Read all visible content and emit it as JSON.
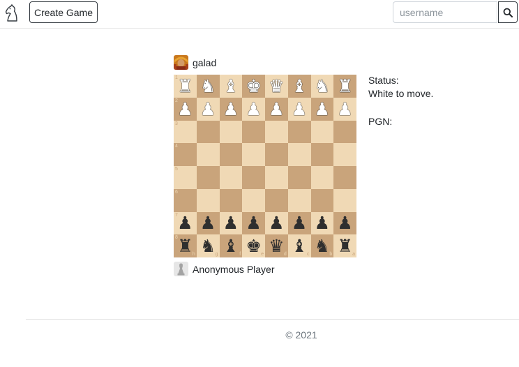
{
  "header": {
    "logo_icon": "knight-logo-icon",
    "create_button_label": "Create Game",
    "search": {
      "placeholder": "username",
      "value": "",
      "button_icon": "search-icon"
    }
  },
  "players": {
    "top": {
      "name": "galad",
      "avatar_icon": "user-avatar-icon"
    },
    "bottom": {
      "name": "Anonymous Player",
      "avatar_icon": "default-avatar-icon"
    }
  },
  "board": {
    "colors": {
      "light": "#f0d9b5",
      "dark": "#c9a47b"
    },
    "ranks_top_to_bottom": [
      "1",
      "2",
      "3",
      "4",
      "5",
      "6",
      "7",
      "8"
    ],
    "files_left_to_right": [
      "h",
      "g",
      "f",
      "e",
      "d",
      "c",
      "b",
      "a"
    ],
    "position": [
      [
        "wR",
        "wN",
        "wB",
        "wK",
        "wQ",
        "wB",
        "wN",
        "wR"
      ],
      [
        "wP",
        "wP",
        "wP",
        "wP",
        "wP",
        "wP",
        "wP",
        "wP"
      ],
      [
        "",
        "",
        "",
        "",
        "",
        "",
        "",
        ""
      ],
      [
        "",
        "",
        "",
        "",
        "",
        "",
        "",
        ""
      ],
      [
        "",
        "",
        "",
        "",
        "",
        "",
        "",
        ""
      ],
      [
        "",
        "",
        "",
        "",
        "",
        "",
        "",
        ""
      ],
      [
        "bP",
        "bP",
        "bP",
        "bP",
        "bP",
        "bP",
        "bP",
        "bP"
      ],
      [
        "bR",
        "bN",
        "bB",
        "bK",
        "bQ",
        "bB",
        "bN",
        "bR"
      ]
    ]
  },
  "status": {
    "status_label": "Status:",
    "status_text": "White to move.",
    "pgn_label": "PGN:",
    "pgn_text": ""
  },
  "footer": {
    "text": "© 2021"
  }
}
